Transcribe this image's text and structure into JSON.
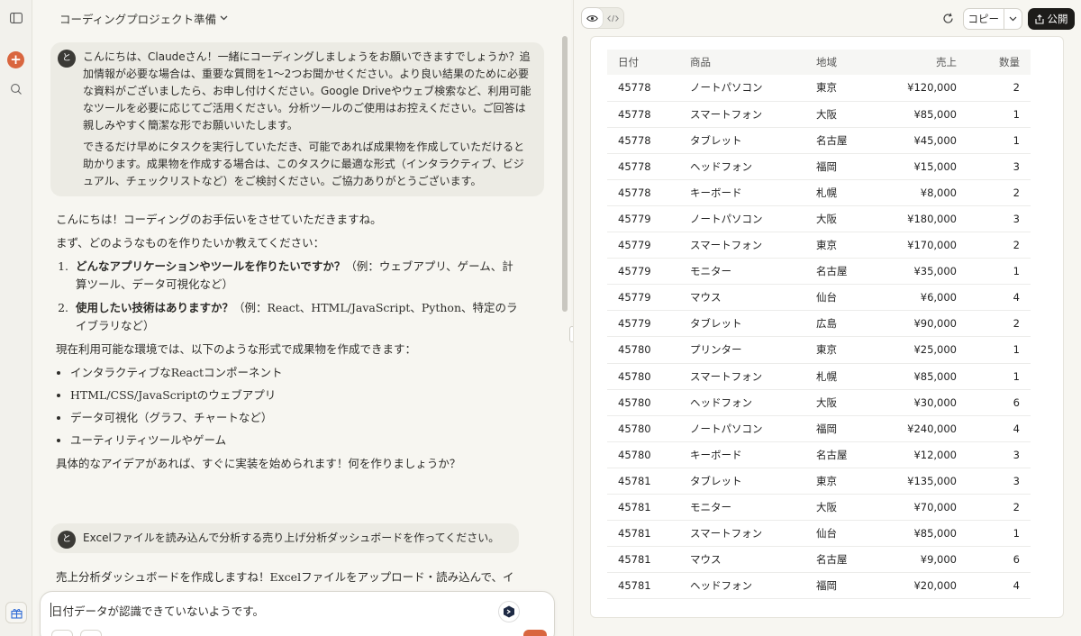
{
  "chat": {
    "project_title": "コーディングプロジェクト準備",
    "user_initial": "と",
    "user_message_1": {
      "para1": "こんにちは、Claudeさん！一緒にコーディングしましょうをお願いできますでしょうか？追加情報が必要な場合は、重要な質問を1〜2つお聞かせください。より良い結果のために必要な資料がございましたら、お申し付けください。Google Driveやウェブ検索など、利用可能なツールを必要に応じてご活用ください。分析ツールのご使用はお控えください。ご回答は親しみやすく簡潔な形でお願いいたします。",
      "para2": "できるだけ早めにタスクを実行していただき、可能であれば成果物を作成していただけると助かります。成果物を作成する場合は、このタスクに最適な形式（インタラクティブ、ビジュアル、チェックリストなど）をご検討ください。ご協力ありがとうございます。"
    },
    "assistant_message_1": {
      "greeting": "こんにちは！コーディングのお手伝いをさせていただきますね。",
      "ask": "まず、どのようなものを作りたいか教えてください：",
      "q1_bold": "どんなアプリケーションやツールを作りたいですか？",
      "q1_rest": "（例：ウェブアプリ、ゲーム、計算ツール、データ可視化など）",
      "q2_bold": "使用したい技術はありますか？",
      "q2_rest": "（例：React、HTML/JavaScript、Python、特定のライブラリなど）",
      "env": "現在利用可能な環境では、以下のような形式で成果物を作成できます：",
      "bullets": [
        "インタラクティブなReactコンポーネント",
        "HTML/CSS/JavaScriptのウェブアプリ",
        "データ可視化（グラフ、チャートなど）",
        "ユーティリティツールやゲーム"
      ],
      "closing": "具体的なアイデアがあれば、すぐに実装を始められます！何を作りましょうか？"
    },
    "user_message_2": "Excelファイルを読み込んで分析する売り上げ分析ダッシュボードを作ってください。",
    "assistant_message_2": "売上分析ダッシュボードを作成しますね！Excelファイルをアップロード・読み込んで、イン",
    "input_value": "日付データが認識できていないようです。"
  },
  "artifact": {
    "copy_label": "コピー",
    "publish_label": "公開",
    "table": {
      "headers": [
        "日付",
        "商品",
        "地域",
        "売上",
        "数量"
      ],
      "rows": [
        [
          "45778",
          "ノートパソコン",
          "東京",
          "¥120,000",
          "2"
        ],
        [
          "45778",
          "スマートフォン",
          "大阪",
          "¥85,000",
          "1"
        ],
        [
          "45778",
          "タブレット",
          "名古屋",
          "¥45,000",
          "1"
        ],
        [
          "45778",
          "ヘッドフォン",
          "福岡",
          "¥15,000",
          "3"
        ],
        [
          "45778",
          "キーボード",
          "札幌",
          "¥8,000",
          "2"
        ],
        [
          "45779",
          "ノートパソコン",
          "大阪",
          "¥180,000",
          "3"
        ],
        [
          "45779",
          "スマートフォン",
          "東京",
          "¥170,000",
          "2"
        ],
        [
          "45779",
          "モニター",
          "名古屋",
          "¥35,000",
          "1"
        ],
        [
          "45779",
          "マウス",
          "仙台",
          "¥6,000",
          "4"
        ],
        [
          "45779",
          "タブレット",
          "広島",
          "¥90,000",
          "2"
        ],
        [
          "45780",
          "プリンター",
          "東京",
          "¥25,000",
          "1"
        ],
        [
          "45780",
          "スマートフォン",
          "札幌",
          "¥85,000",
          "1"
        ],
        [
          "45780",
          "ヘッドフォン",
          "大阪",
          "¥30,000",
          "6"
        ],
        [
          "45780",
          "ノートパソコン",
          "福岡",
          "¥240,000",
          "4"
        ],
        [
          "45780",
          "キーボード",
          "名古屋",
          "¥12,000",
          "3"
        ],
        [
          "45781",
          "タブレット",
          "東京",
          "¥135,000",
          "3"
        ],
        [
          "45781",
          "モニター",
          "大阪",
          "¥70,000",
          "2"
        ],
        [
          "45781",
          "スマートフォン",
          "仙台",
          "¥85,000",
          "1"
        ],
        [
          "45781",
          "マウス",
          "名古屋",
          "¥9,000",
          "6"
        ],
        [
          "45781",
          "ヘッドフォン",
          "福岡",
          "¥20,000",
          "4"
        ]
      ]
    }
  },
  "colors": {
    "accent": "#d9663f",
    "publish_bg": "#1d1c1a"
  }
}
